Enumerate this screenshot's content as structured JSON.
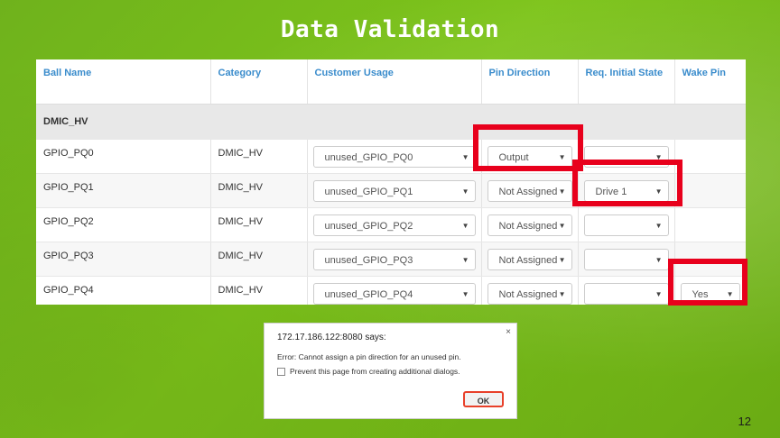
{
  "slide": {
    "title": "Data Validation",
    "page_number": "12"
  },
  "table": {
    "headers": [
      "Ball Name",
      "Category",
      "Customer Usage",
      "Pin Direction",
      "Req. Initial State",
      "Wake Pin"
    ],
    "group_label": "DMIC_HV",
    "rows": [
      {
        "ball": "GPIO_PQ0",
        "category": "DMIC_HV",
        "usage": "unused_GPIO_PQ0",
        "direction": "Output",
        "initial_state": "",
        "wake": ""
      },
      {
        "ball": "GPIO_PQ1",
        "category": "DMIC_HV",
        "usage": "unused_GPIO_PQ1",
        "direction": "Not Assigned",
        "initial_state": "Drive 1",
        "wake": ""
      },
      {
        "ball": "GPIO_PQ2",
        "category": "DMIC_HV",
        "usage": "unused_GPIO_PQ2",
        "direction": "Not Assigned",
        "initial_state": "",
        "wake": ""
      },
      {
        "ball": "GPIO_PQ3",
        "category": "DMIC_HV",
        "usage": "unused_GPIO_PQ3",
        "direction": "Not Assigned",
        "initial_state": "",
        "wake": ""
      },
      {
        "ball": "GPIO_PQ4",
        "category": "DMIC_HV",
        "usage": "unused_GPIO_PQ4",
        "direction": "Not Assigned",
        "initial_state": "",
        "wake": "Yes"
      }
    ]
  },
  "dialog": {
    "title": "172.17.186.122:8080 says:",
    "close": "×",
    "message": "Error: Cannot assign a pin direction for an unused pin.",
    "checkbox_label": "Prevent this page from creating additional dialogs.",
    "ok_label": "OK"
  },
  "colors": {
    "background": "#76b900",
    "highlight": "#e8001c",
    "header_text": "#3a8ccc"
  },
  "icons": {
    "dropdown": "caret-down-icon"
  }
}
